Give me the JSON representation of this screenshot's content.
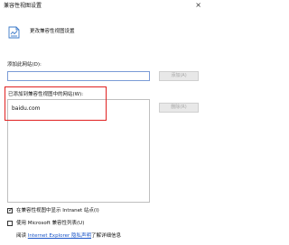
{
  "window": {
    "title": "兼容性视图设置",
    "close_glyph": "×"
  },
  "header": {
    "icon": "compat-view-icon",
    "text": "更改兼容性视图设置"
  },
  "add_section": {
    "label": "添加此网站(D):",
    "input_value": "",
    "add_button": "添加(A)"
  },
  "list_section": {
    "label": "已添加到兼容性视图中的网站(W):",
    "sites": [
      "baidu.com"
    ],
    "remove_button": "删除(R)"
  },
  "options": {
    "intranet": {
      "label": "在兼容性视图中显示 Intranet 站点(I)",
      "checked": true,
      "glyph": "✓"
    },
    "ms_list": {
      "label": "使用 Microsoft 兼容性列表(U)",
      "checked": false
    }
  },
  "footer": {
    "prefix": "阅读 ",
    "link": "Internet Explorer 隐私声明",
    "suffix": "了解详细信息"
  },
  "colors": {
    "highlight": "#e02020",
    "link": "#1a55c8",
    "input_border": "#7a9bd6"
  }
}
